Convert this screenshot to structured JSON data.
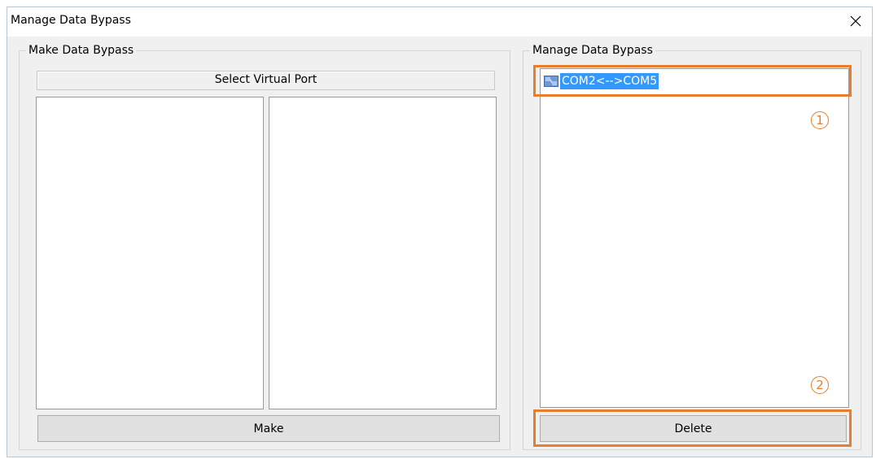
{
  "window": {
    "title": "Manage Data Bypass"
  },
  "make_group": {
    "label": "Make Data Bypass",
    "header": "Select Virtual Port",
    "make_button": "Make"
  },
  "manage_group": {
    "label": "Manage Data Bypass",
    "items": [
      {
        "label": "COM2<-->COM5",
        "selected": true
      }
    ],
    "delete_button": "Delete"
  },
  "annotations": {
    "callout_1": "1",
    "callout_2": "2",
    "color": "#e87d2c"
  }
}
